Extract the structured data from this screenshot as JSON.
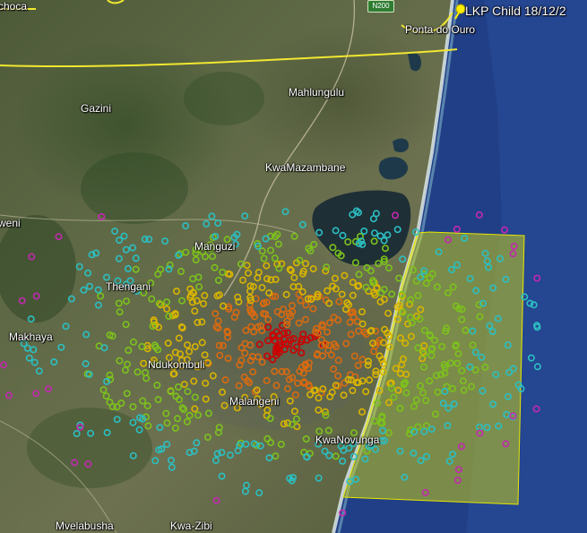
{
  "map": {
    "places": {
      "choca": "choca",
      "ponta_do_ouro": "Ponta do Ouro",
      "mahlungulu": "Mahlungulu",
      "gazini": "Gazini",
      "kwamazambane": "KwaMazambane",
      "weni": "weni",
      "manguzi": "Manguzi",
      "thengani": "Thengani",
      "makhaya": "Makhaya",
      "ndukombuli": "Ndukombuli",
      "malangeni": "Malangeni",
      "kwanovunga": "KwaNovunga",
      "mvelabusha": "Mvelabusha",
      "kwa_zibi": "Kwa-Zibi"
    },
    "road_shield": "N200",
    "pin": {
      "label": "LKP Child 18/12/2",
      "icon": "pushpin-icon",
      "color": "#ffee00"
    },
    "border_color": "#f2e830",
    "ocean_color": "#1f3f8c",
    "highlight_zone_color": "#e8e800",
    "marker_colors": [
      "#cc0000",
      "#d96a10",
      "#d9b400",
      "#7cc21c",
      "#2bbfc2",
      "#c229b0"
    ]
  }
}
